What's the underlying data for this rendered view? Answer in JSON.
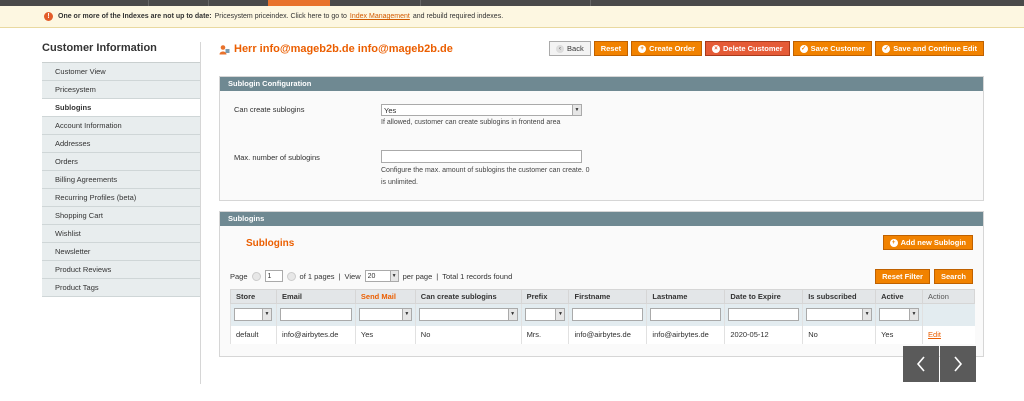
{
  "notice": {
    "bold": "One or more of the Indexes are not up to date:",
    "text_before": "Pricesystem priceindex. Click here to go to",
    "link": "Index Management",
    "text_after": "and rebuild required indexes."
  },
  "sidebar": {
    "title": "Customer Information",
    "items": [
      {
        "label": "Customer View"
      },
      {
        "label": "Pricesystem"
      },
      {
        "label": "Sublogins"
      },
      {
        "label": "Account Information"
      },
      {
        "label": "Addresses"
      },
      {
        "label": "Orders"
      },
      {
        "label": "Billing Agreements"
      },
      {
        "label": "Recurring Profiles (beta)"
      },
      {
        "label": "Shopping Cart"
      },
      {
        "label": "Wishlist"
      },
      {
        "label": "Newsletter"
      },
      {
        "label": "Product Reviews"
      },
      {
        "label": "Product Tags"
      }
    ],
    "active_index": 2
  },
  "header": {
    "title": "Herr info@mageb2b.de info@mageb2b.de",
    "buttons": {
      "back": "Back",
      "reset": "Reset",
      "create_order": "Create Order",
      "delete_customer": "Delete Customer",
      "save_customer": "Save Customer",
      "save_continue": "Save and Continue Edit"
    }
  },
  "config": {
    "heading": "Sublogin Configuration",
    "can_create_label": "Can create sublogins",
    "can_create_value": "Yes",
    "can_create_note": "If allowed, customer can create sublogins in frontend area",
    "max_label": "Max. number of sublogins",
    "max_value": "",
    "max_note": "Configure the max. amount of sublogins the customer can create. 0 is unlimited."
  },
  "sublogins": {
    "heading": "Sublogins",
    "title": "Sublogins",
    "add_button": "Add new Sublogin",
    "reset_filter": "Reset Filter",
    "search": "Search",
    "pager": {
      "page_label": "Page",
      "page_value": "1",
      "of_pages": "of 1 pages",
      "view_label": "View",
      "view_value": "20",
      "per_page": "per page",
      "total": "Total 1 records found"
    },
    "columns": [
      "Store",
      "Email",
      "Send Mail",
      "Can create sublogins",
      "Prefix",
      "Firstname",
      "Lastname",
      "Date to Expire",
      "Is subscribed",
      "Active",
      "Action"
    ],
    "rows": [
      {
        "store": "default",
        "email": "info@airbytes.de",
        "send_mail": "Yes",
        "can_create": "No",
        "prefix": "Mrs.",
        "firstname": "info@airbytes.de",
        "lastname": "info@airbytes.de",
        "expire": "2020-05-12",
        "subscribed": "No",
        "active": "Yes",
        "action": "Edit"
      }
    ]
  },
  "colors": {
    "accent": "#eb5e00",
    "button": "#f18200",
    "header_bar": "#6f8992",
    "sidebar_bg": "#e8edee"
  }
}
